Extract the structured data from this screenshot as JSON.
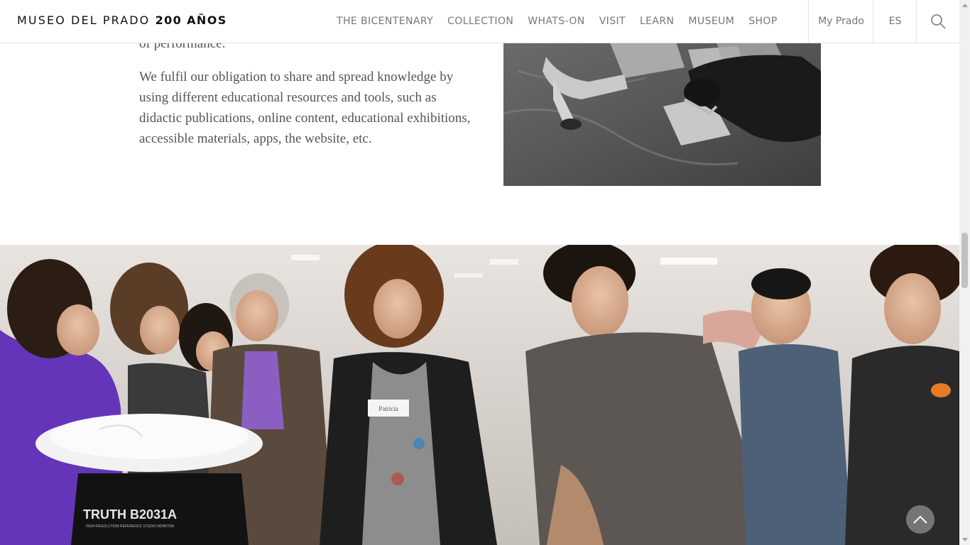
{
  "header": {
    "logo_light": "MUSEO DEL PRADO ",
    "logo_bold": "200 AÑOS",
    "nav": [
      "THE BICENTENARY",
      "COLLECTION",
      "WHATS-ON",
      "VISIT",
      "LEARN",
      "MUSEUM",
      "SHOP"
    ],
    "my_prado": "My Prado",
    "language": "ES",
    "search_icon": "search-icon"
  },
  "content": {
    "partial_text": "of performance.",
    "paragraph": "We fulfil our obligation to share and spread knowledge by using different educational resources and tools, such as didactic publications, online content, educational exhibitions, accessible materials, apps, the website, etc.",
    "speaker_label": "TRUTH B2031A",
    "speaker_sublabel": "HIGH-RESOLUTION REFERENCE STUDIO MONITOR",
    "name_tag": "Patricia"
  },
  "colors": {
    "text": "#555555",
    "nav_text": "#777777",
    "divider": "#e3e3e3",
    "back_to_top": "#828282"
  },
  "icons": {
    "back_to_top": "chevron-up-icon"
  }
}
